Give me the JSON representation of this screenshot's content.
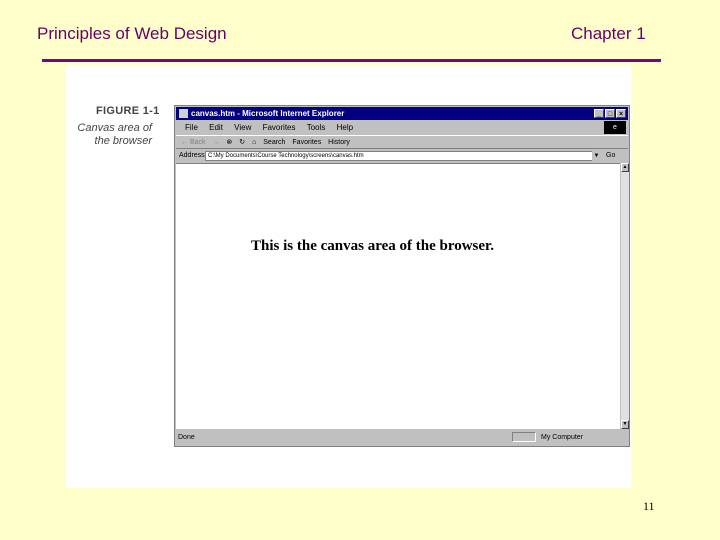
{
  "slide": {
    "title_left": "Principles of Web Design",
    "title_right": "Chapter 1",
    "page_number": "11"
  },
  "figure": {
    "label": "FIGURE 1-1",
    "caption": "Canvas area of the browser"
  },
  "browser": {
    "window_title": "canvas.htm - Microsoft Internet Explorer",
    "window_buttons": [
      "_",
      "□",
      "×"
    ],
    "menu": [
      "File",
      "Edit",
      "View",
      "Favorites",
      "Tools",
      "Help"
    ],
    "toolbar": {
      "back": "← Back",
      "forward": "→",
      "stop": "⊗",
      "refresh": "↻",
      "home": "⌂",
      "search": "Search",
      "favorites": "Favorites",
      "history": "History"
    },
    "address": {
      "label": "Address",
      "value": "C:\\My Documents\\Course Technology\\screens\\canvas.htm",
      "go": "Go"
    },
    "canvas_text": "This is the canvas area of the browser.",
    "status": {
      "left": "Done",
      "right": "My Computer"
    }
  },
  "colors": {
    "slide_background": "#ffffcc",
    "title_text": "#660066",
    "rule": "#800080",
    "titlebar": "#000080"
  }
}
